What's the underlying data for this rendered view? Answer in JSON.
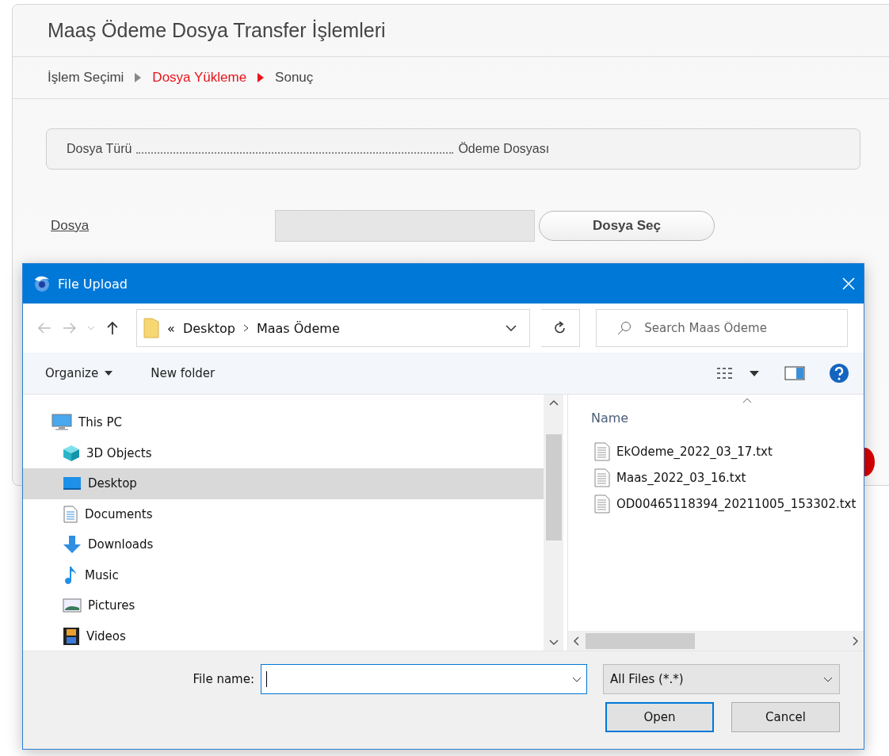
{
  "page": {
    "title": "Maaş Ödeme Dosya Transfer İşlemleri",
    "breadcrumb": [
      {
        "label": "İşlem Seçimi",
        "selected": false
      },
      {
        "label": "Dosya Yükleme",
        "selected": true
      },
      {
        "label": "Sonuç",
        "selected": false
      }
    ],
    "info": {
      "label": "Dosya Türü",
      "value": "Ödeme Dosyası"
    },
    "file_row": {
      "label": "Dosya",
      "button": "Dosya Seç"
    }
  },
  "dialog": {
    "title": "File Upload",
    "address": {
      "overflow": "«",
      "path": [
        "Desktop",
        "Maas Ödeme"
      ]
    },
    "search": {
      "placeholder": "Search Maas Ödeme"
    },
    "toolbar": {
      "organize": "Organize",
      "new_folder": "New folder"
    },
    "tree": [
      {
        "label": "This PC",
        "selected": false,
        "children": [
          {
            "label": "3D Objects",
            "selected": false
          },
          {
            "label": "Desktop",
            "selected": true
          },
          {
            "label": "Documents",
            "selected": false
          },
          {
            "label": "Downloads",
            "selected": false
          },
          {
            "label": "Music",
            "selected": false
          },
          {
            "label": "Pictures",
            "selected": false
          },
          {
            "label": "Videos",
            "selected": false
          }
        ]
      }
    ],
    "files": {
      "column": "Name",
      "items": [
        "EkOdeme_2022_03_17.txt",
        "Maas_2022_03_16.txt",
        "OD00465118394_20211005_153302.txt"
      ]
    },
    "file_name": {
      "label": "File name:"
    },
    "filter": "All Files (*.*)",
    "buttons": [
      {
        "label": "Open",
        "selected": true
      },
      {
        "label": "Cancel",
        "selected": false
      }
    ]
  }
}
